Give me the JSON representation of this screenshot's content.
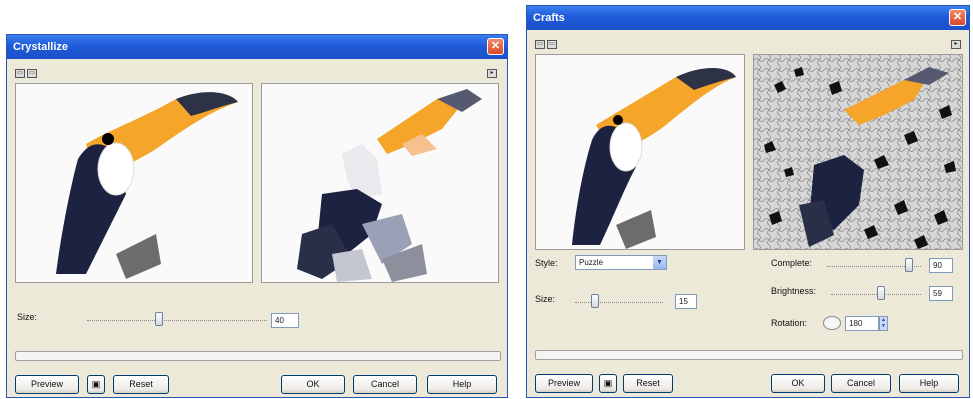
{
  "crystallize": {
    "title": "Crystallize",
    "close_icon": "close-icon",
    "size_label": "Size:",
    "size_value": "40",
    "buttons": {
      "preview": "Preview",
      "reset": "Reset",
      "ok": "OK",
      "cancel": "Cancel",
      "help": "Help"
    }
  },
  "crafts": {
    "title": "Crafts",
    "style_label": "Style:",
    "style_value": "Puzzle",
    "size_label": "Size:",
    "size_value": "15",
    "complete_label": "Complete:",
    "complete_value": "90",
    "brightness_label": "Brightness:",
    "brightness_value": "59",
    "rotation_label": "Rotation:",
    "rotation_value": "180",
    "buttons": {
      "preview": "Preview",
      "reset": "Reset",
      "ok": "OK",
      "cancel": "Cancel",
      "help": "Help"
    }
  },
  "colors": {
    "title_bar": "#1f5ad8",
    "dialog_bg": "#ece9d8",
    "toucan_beak": "#f4a52a",
    "toucan_body": "#1c2240"
  }
}
